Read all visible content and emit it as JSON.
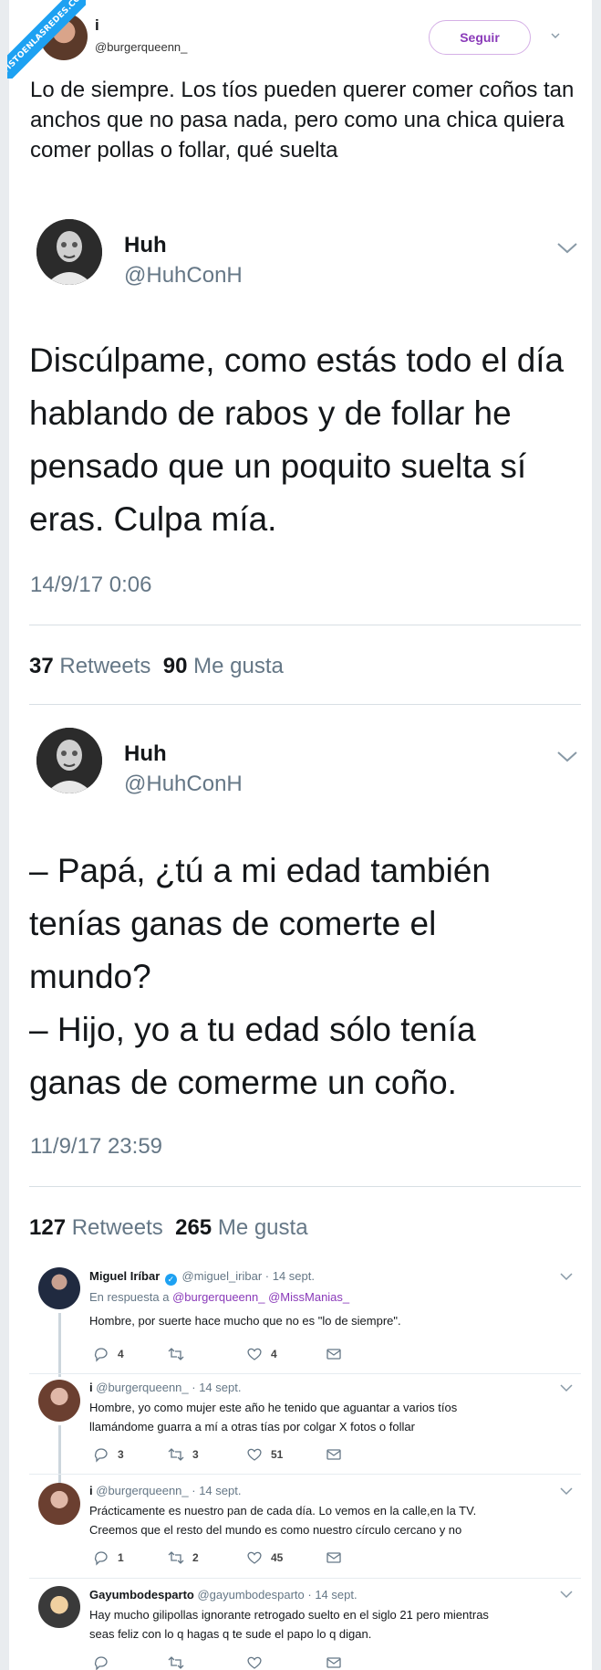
{
  "watermark": {
    "text": "VISTOENLASREDES.COM"
  },
  "header_tweet": {
    "name": "i",
    "handle": "@burgerqueenn_",
    "follow_label": "Seguir",
    "text": "Lo de siempre. Los tíos pueden querer comer coños tan anchos que no pasa nada, pero como una chica quiera comer pollas o follar, qué suelta"
  },
  "quoted": [
    {
      "name": "Huh",
      "handle": "@HuhConH",
      "avatar_badge": "HuhConH",
      "text": "Discúlpame, como estás todo el día hablando de rabos y de follar he pensado que un poquito suelta sí eras. Culpa mía.",
      "time": "14/9/17 0:06",
      "retweets": "37",
      "retweets_label": "Retweets",
      "likes": "90",
      "likes_label": "Me gusta"
    },
    {
      "name": "Huh",
      "handle": "@HuhConH",
      "avatar_badge": "HuhConH",
      "text_lines": [
        "– Papá, ¿tú a mi edad también",
        "tenías ganas de comerte el",
        "mundo?",
        "– Hijo, yo a tu edad sólo tenía",
        "ganas de comerme un coño."
      ],
      "time": "11/9/17 23:59",
      "retweets": "127",
      "retweets_label": "Retweets",
      "likes": "265",
      "likes_label": "Me gusta"
    }
  ],
  "replies": [
    {
      "name": "Miguel Iríbar",
      "verified": true,
      "handle": "@miguel_iribar",
      "date": "14 sept.",
      "reply_to_label": "En respuesta a",
      "reply_to": [
        "@burgerqueenn_",
        "@MissManias_"
      ],
      "lines": [
        "Hombre, por suerte hace mucho que no es \"lo de siempre\"."
      ],
      "replies_count": "4",
      "retweets_count": "",
      "likes_count": "4"
    },
    {
      "name": "i",
      "verified": false,
      "handle": "@burgerqueenn_",
      "date": "14 sept.",
      "lines": [
        "Hombre, yo como mujer este año he tenido que aguantar a varios tíos",
        "llamándome guarra a mí a otras tías por colgar X fotos o follar"
      ],
      "replies_count": "3",
      "retweets_count": "3",
      "likes_count": "51"
    },
    {
      "name": "i",
      "verified": false,
      "handle": "@burgerqueenn_",
      "date": "14 sept.",
      "lines": [
        "Prácticamente es nuestro pan de cada día. Lo vemos en la calle,en la TV.",
        "Creemos que el resto del mundo es como nuestro círculo cercano y no"
      ],
      "replies_count": "1",
      "retweets_count": "2",
      "likes_count": "45"
    },
    {
      "name": "Gayumbodesparto",
      "verified": false,
      "handle": "@gayumbodesparto",
      "date": "14 sept.",
      "lines": [
        "Hay mucho gilipollas ignorante retrogado suelto en el siglo 21 pero mientras",
        "seas feliz con lo q hagas q te sude el papo lo q digan."
      ],
      "replies_count": "",
      "retweets_count": "",
      "likes_count": ""
    }
  ],
  "colors": {
    "accent": "#8a3ab9",
    "muted": "#657786",
    "divider": "#d8dfe4"
  }
}
